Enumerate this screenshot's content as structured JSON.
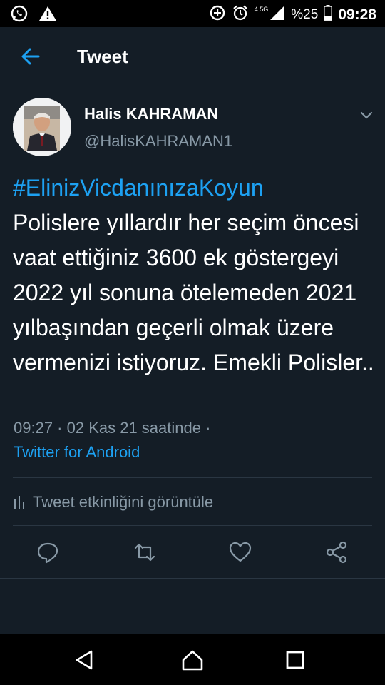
{
  "status_bar": {
    "battery": "%25",
    "time": "09:28",
    "network": "4.5G",
    "icons": [
      "whatsapp-icon",
      "warning-icon",
      "data-saver-icon",
      "alarm-icon",
      "signal-icon",
      "battery-icon"
    ]
  },
  "header": {
    "title": "Tweet",
    "back_icon": "arrow-left-icon"
  },
  "tweet": {
    "author_name": "Halis KAHRAMAN",
    "author_handle": "@HalisKAHRAMAN1",
    "hashtag": "#ElinizVicdanınızaKoyun",
    "body": "Polislere yıllardır her seçim öncesi vaat ettiğiniz 3600 ek göstergeyi 2022 yıl sonuna ötelemeden 2021 yılbaşından geçerli olmak üzere vermenizi istiyoruz. Emekli Polisler..",
    "meta": "09:27 · 02 Kas 21 saatinde ·",
    "source": "Twitter for Android",
    "activity_label": "Tweet etkinliğini görüntüle"
  },
  "actions": [
    "reply-icon",
    "retweet-icon",
    "like-icon",
    "share-icon"
  ],
  "colors": {
    "background": "#141d26",
    "accent": "#1da1f2",
    "secondary_text": "#8899a6",
    "divider": "#2a3642"
  },
  "nav_bar": [
    "back-triangle-icon",
    "home-circle-icon",
    "recents-square-icon"
  ]
}
